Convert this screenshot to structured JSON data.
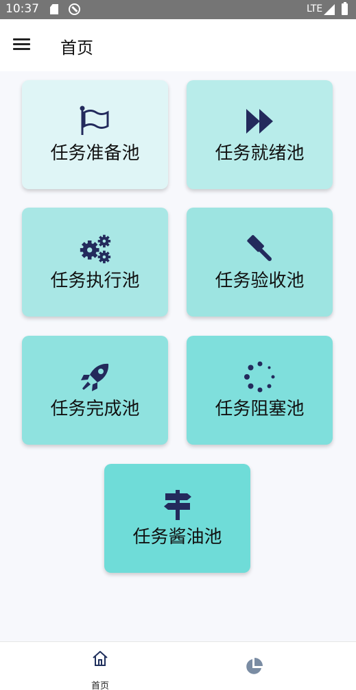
{
  "status_bar": {
    "time": "10:37",
    "network": "LTE"
  },
  "app_bar": {
    "title": "首页"
  },
  "cards": [
    {
      "label": "任务准备池",
      "icon": "flag-icon",
      "color": "#dff5f6"
    },
    {
      "label": "任务就绪池",
      "icon": "fast-forward-icon",
      "color": "#b8ecea"
    },
    {
      "label": "任务执行池",
      "icon": "gears-icon",
      "color": "#a9e7e5"
    },
    {
      "label": "任务验收池",
      "icon": "gavel-icon",
      "color": "#9de4e1"
    },
    {
      "label": "任务完成池",
      "icon": "rocket-icon",
      "color": "#8fe2df"
    },
    {
      "label": "任务阻塞池",
      "icon": "spinner-icon",
      "color": "#7fdfdc"
    },
    {
      "label": "任务酱油池",
      "icon": "signpost-icon",
      "color": "#6fdcd8"
    }
  ],
  "bottom_nav": {
    "home_label": "首页",
    "home_icon": "home-icon",
    "stats_icon": "pie-chart-icon"
  },
  "colors": {
    "icon": "#232a5c",
    "status_bar": "#757575",
    "background": "#f7f8fc"
  }
}
